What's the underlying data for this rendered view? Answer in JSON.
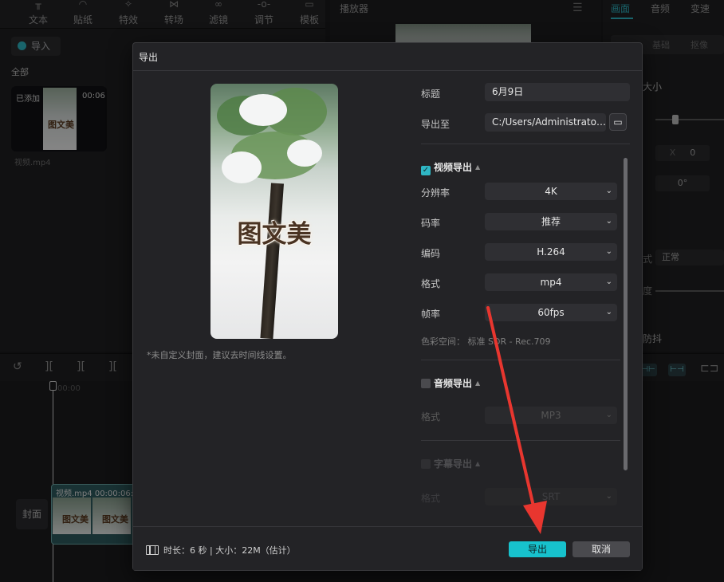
{
  "toolbar": {
    "items": [
      {
        "label": "文本",
        "icon": "text-icon"
      },
      {
        "label": "贴纸",
        "icon": "sticker-icon"
      },
      {
        "label": "特效",
        "icon": "effects-icon"
      },
      {
        "label": "转场",
        "icon": "transition-icon"
      },
      {
        "label": "滤镜",
        "icon": "filter-icon"
      },
      {
        "label": "调节",
        "icon": "adjust-icon"
      },
      {
        "label": "模板",
        "icon": "template-icon"
      }
    ]
  },
  "media": {
    "import_label": "导入",
    "all_label": "全部",
    "thumb_badge": "已添加",
    "thumb_duration": "00:06",
    "thumb_name": "视频.mp4",
    "thumb_mark": "图文美"
  },
  "player": {
    "title": "播放器"
  },
  "right_panel": {
    "tabs": [
      "画面",
      "音频",
      "变速"
    ],
    "active_tab": "画面",
    "subtabs": [
      "基础",
      "抠像"
    ],
    "size_label": "大小",
    "x_label": "X",
    "x_value": "0",
    "rotate_value": "0°",
    "blend_mode_label": "式",
    "blend_mode_value": "正常",
    "opacity_label": "度",
    "stabilize_label": "防抖"
  },
  "timeline": {
    "time_label": "00:00",
    "cover_label": "封面",
    "clip_name": "视频.mp4",
    "clip_duration": "00:00:06:",
    "clip_mark": "图文美"
  },
  "dialog": {
    "title": "导出",
    "cover_text": "图文美",
    "cover_note": "*未自定义封面，建议去时间线设置。",
    "title_label": "标题",
    "title_value": "6月9日",
    "path_label": "导出至",
    "path_value": "C:/Users/Administrator/...",
    "video_section": {
      "label": "视频导出",
      "checked": true,
      "fields": [
        {
          "label": "分辨率",
          "value": "4K"
        },
        {
          "label": "码率",
          "value": "推荐"
        },
        {
          "label": "编码",
          "value": "H.264"
        },
        {
          "label": "格式",
          "value": "mp4"
        },
        {
          "label": "帧率",
          "value": "60fps"
        }
      ],
      "color_space": "色彩空间：  标准 SDR - Rec.709"
    },
    "audio_section": {
      "label": "音频导出",
      "checked": false,
      "format_label": "格式",
      "format_value": "MP3"
    },
    "subtitle_section": {
      "label": "字幕导出",
      "checked": false,
      "format_label": "格式",
      "format_value": "SRT"
    },
    "footer_info": "时长：6 秒 | 大小：22M（估计）",
    "export_label": "导出",
    "cancel_label": "取消"
  },
  "colors": {
    "accent": "#17c2cd",
    "arrow": "#e8362f"
  }
}
